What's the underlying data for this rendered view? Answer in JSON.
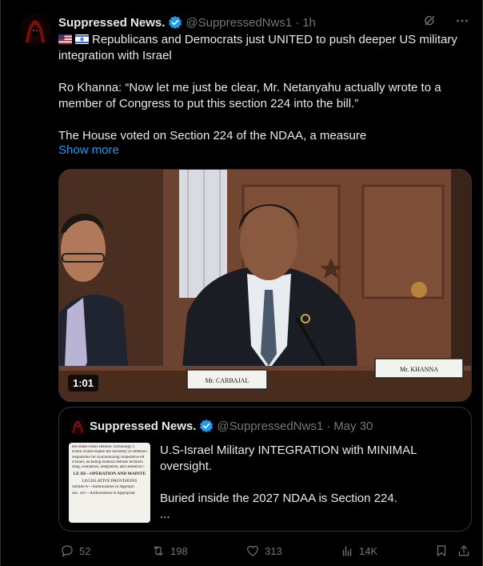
{
  "tweet": {
    "author_name": "Suppressed News.",
    "handle": "@SuppressedNws1",
    "separator": "·",
    "time": "1h",
    "text_line1": "Republicans and Democrats just UNITED to push deeper US military integration with Israel",
    "text_quote": "Ro Khanna: “Now let me just be clear, Mr. Netanyahu actually wrote to a member of Congress to put this section 224 into the bill.”",
    "text_house": "The House voted on Section 224 of the NDAA, a measure",
    "show_more": "Show more",
    "flags": [
      "us-flag",
      "israel-flag"
    ]
  },
  "video": {
    "duration": "1:01",
    "nameplate_left": "Mr. CARBAJAL",
    "nameplate_right": "Mr. KHANNA"
  },
  "quoted_tweet": {
    "author_name": "Suppressed News.",
    "handle": "@SuppressedNws1",
    "separator": "·",
    "date": "May 30",
    "text_line1": "U.S-Israel Military INTEGRATION with MINIMAL oversight.",
    "text_line2": "Buried inside the 2027 NDAA is Section 224.",
    "text_line3": "...",
    "thumbnail_lines": [
      "ted States-Israel Defense Technology C",
      "ection would require the Secretary of Defense t",
      "responsible for synchronizing cooperative eff",
      "d Israel, including bilateral defense technolo",
      "sting, evaluation, integration, and industrial c"
    ],
    "thumbnail_heading1": "LE III—OPERATION AND MAINTE",
    "thumbnail_heading2": "LEGISLATIVE PROVISIONS",
    "thumbnail_line_subtitle": "Subtitle A—Authorization of Appropri",
    "thumbnail_line_sec": "Sec. 301—Authorization of Appropriat"
  },
  "actions": {
    "replies": "52",
    "reposts": "198",
    "likes": "313",
    "views": "14K"
  },
  "colors": {
    "background": "#000000",
    "text": "#e7e9ea",
    "muted": "#71767b",
    "link": "#1d9bf0",
    "border": "#2f3336",
    "verified": "#1d9bf0"
  }
}
